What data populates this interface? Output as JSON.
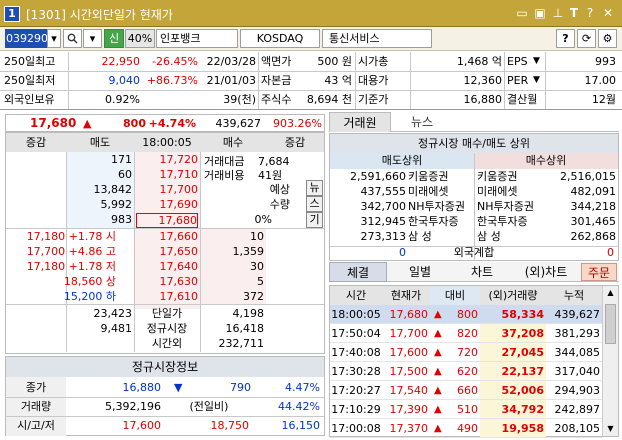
{
  "window": {
    "title": "[1301] 시간외단일가 현재가",
    "num": "1",
    "icons": [
      "restore-icon",
      "maximize-icon",
      "pin-icon",
      "text-icon",
      "help-icon",
      "close-icon"
    ]
  },
  "toolbar": {
    "code": "039290",
    "letter": "신",
    "margin": "40%",
    "name": "인포뱅크",
    "market": "KOSDAQ",
    "sector": "통신서비스",
    "btn_q": "?",
    "btn_refresh": "⟳",
    "btn_gear": "⚙"
  },
  "info": {
    "r1": {
      "l1": "250일최고",
      "v1": "22,950",
      "v2": "-26.45%",
      "v3": "22/03/28",
      "l2": "액면가",
      "v4": "500 원",
      "l3": "시가총",
      "v5": "1,468 억",
      "l4": "EPS",
      "v6": "993"
    },
    "r2": {
      "l1": "250일최저",
      "v1": "9,040",
      "v2": "+86.73%",
      "v3": "21/01/03",
      "l2": "자본금",
      "v4": "43 억",
      "l3": "대용가",
      "v5": "12,360",
      "l4": "PER",
      "v6": "17.00"
    },
    "r3": {
      "l1": "외국인보유",
      "v1": "0.92%",
      "v3": "39(천)",
      "l2": "주식수",
      "v4": "8,694 천",
      "l3": "기준가",
      "v5": "16,880",
      "l4": "결산월",
      "v6": "12월"
    }
  },
  "price": {
    "current": "17,680",
    "arrow": "▲",
    "change": "800",
    "rate": "+4.74%",
    "volume": "439,627",
    "ratio": "903.26%"
  },
  "ob_header": {
    "c1": "증감",
    "c2": "매도",
    "time": "18:00:05",
    "c4": "매수",
    "c5": "증감"
  },
  "ob_sell": [
    {
      "qty": "171",
      "price": "17,720"
    },
    {
      "qty": "60",
      "price": "17,710"
    },
    {
      "qty": "13,842",
      "price": "17,700"
    },
    {
      "qty": "5,992",
      "price": "17,690"
    },
    {
      "qty": "983",
      "price": "17,680"
    }
  ],
  "ob_buy": [
    {
      "price": "17,660",
      "qty": "10"
    },
    {
      "price": "17,650",
      "qty": "1,359"
    },
    {
      "price": "17,640",
      "qty": "30"
    },
    {
      "price": "17,630",
      "qty": "5"
    },
    {
      "price": "17,610",
      "qty": "372"
    }
  ],
  "ob_info": {
    "amount_label": "거래대금",
    "amount": "7,684",
    "cost_label": "거래비용",
    "cost": "41원",
    "exp_label": "예상",
    "qty_label": "수량",
    "pct": "0%",
    "side_btns": [
      "뉴",
      "스",
      "기"
    ]
  },
  "ob_left": [
    {
      "label": "17,180 +1.78 시",
      "cls": "red"
    },
    {
      "label": "17,700 +4.86 고",
      "cls": "red"
    },
    {
      "label": "17,180 +1.78 저",
      "cls": "red"
    },
    {
      "label": "18,560 상",
      "cls": "red"
    },
    {
      "label": "15,200 하",
      "cls": "blue"
    }
  ],
  "ob_total": {
    "sell": "23,423",
    "label": "단일가",
    "buy": "4,198"
  },
  "ob_reg": {
    "sell": "9,481",
    "label": "정규시장",
    "buy": "16,418"
  },
  "ob_ext": {
    "label": "시간외",
    "buy": "232,711"
  },
  "reg": {
    "title": "정규시장정보",
    "close_label": "종가",
    "close": "16,880",
    "close_arrow": "▼",
    "close_chg": "790",
    "close_rate": "4.47%",
    "vol_label": "거래량",
    "vol": "5,392,196",
    "vol_mid": "(전일비)",
    "vol_rate": "44.42%",
    "ohl_label": "시/고/저",
    "o": "17,600",
    "h": "18,750",
    "l": "16,150"
  },
  "tabs_top": {
    "t1": "거래원",
    "t2": "뉴스"
  },
  "broker": {
    "title": "정규시장 매수/매도 상위",
    "sell_hdr": "매도상위",
    "buy_hdr": "매수상위",
    "rows": [
      {
        "sq": "2,591,660",
        "sn": "키움증권",
        "bn": "키움증권",
        "bq": "2,516,015"
      },
      {
        "sq": "437,555",
        "sn": "미래에셋",
        "bn": "미래에셋",
        "bq": "482,091"
      },
      {
        "sq": "342,700",
        "sn": "NH투자증권",
        "bn": "NH투자증권",
        "bq": "344,218"
      },
      {
        "sq": "312,945",
        "sn": "한국투자증",
        "bn": "한국투자증",
        "bq": "301,465"
      },
      {
        "sq": "273,313",
        "sn": "삼 성",
        "bn": "삼 성",
        "bq": "262,868"
      }
    ],
    "foreign_label": "외국계합",
    "foreign_sell": "0",
    "foreign_buy": "0"
  },
  "tabs_mid": [
    "체결",
    "일별",
    "차트",
    "(외)차트",
    "주문"
  ],
  "trades_hdr": {
    "time": "시간",
    "price": "현재가",
    "chg": "대비",
    "qty": "(외)거래량",
    "cum": "누적"
  },
  "trades": [
    {
      "time": "18:00:05",
      "price": "17,680",
      "chg": "800",
      "qty": "58,334",
      "cum": "439,627"
    },
    {
      "time": "17:50:04",
      "price": "17,700",
      "chg": "820",
      "qty": "37,208",
      "cum": "381,293"
    },
    {
      "time": "17:40:08",
      "price": "17,600",
      "chg": "720",
      "qty": "27,045",
      "cum": "344,085"
    },
    {
      "time": "17:30:28",
      "price": "17,500",
      "chg": "620",
      "qty": "22,137",
      "cum": "317,040"
    },
    {
      "time": "17:20:27",
      "price": "17,540",
      "chg": "660",
      "qty": "52,006",
      "cum": "294,903"
    },
    {
      "time": "17:10:29",
      "price": "17,390",
      "chg": "510",
      "qty": "34,792",
      "cum": "242,897"
    },
    {
      "time": "17:00:08",
      "price": "17,370",
      "chg": "490",
      "qty": "19,958",
      "cum": "208,105"
    }
  ],
  "colors": {
    "title": "#c4a53a",
    "up": "#e00000",
    "down": "#0033cc"
  }
}
